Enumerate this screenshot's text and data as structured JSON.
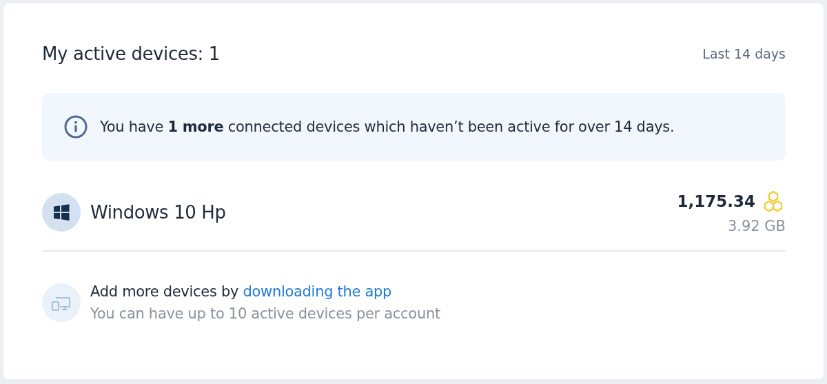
{
  "header": {
    "title": "My active devices: 1",
    "period": "Last 14 days"
  },
  "notice": {
    "text": "You have **1 more** connected devices which haven’t been active for over 14 days."
  },
  "devices": [
    {
      "name": "Windows 10 Hp",
      "points": "1,175.34",
      "storage": "3.92 GB",
      "kind": "windows"
    }
  ],
  "add_devices": {
    "text": "Add more devices by",
    "link": "downloading the app",
    "note": "You can have up to 10 active devices per account"
  }
}
